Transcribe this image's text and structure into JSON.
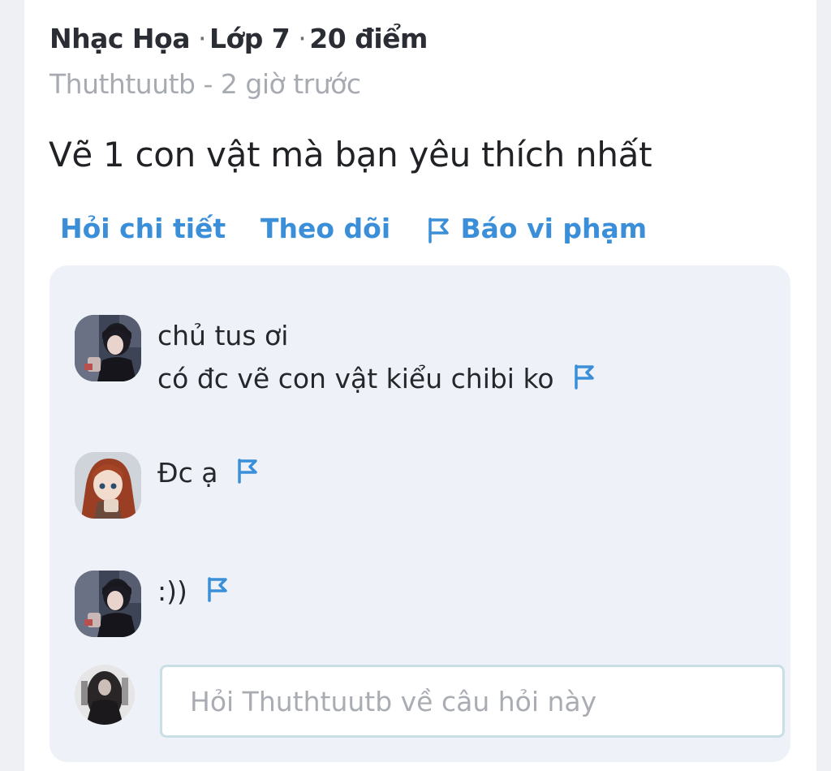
{
  "question": {
    "subject": "Nhạc Họa",
    "grade": "Lớp 7",
    "points": "20 điểm",
    "author": "Thuthtuutb",
    "meta_separator": "-",
    "time": "2 giờ trước",
    "text": "Vẽ 1 con vật mà bạn yêu thích nhất"
  },
  "actions": {
    "ask_detail": "Hỏi chi tiết",
    "follow": "Theo dõi",
    "report": "Báo vi phạm",
    "report_icon": "flag-icon"
  },
  "comments": [
    {
      "lines": [
        "chủ tus ơi",
        "có đc vẽ con vật kiểu chibi ko"
      ],
      "avatar": "user-avatar-dark-hair"
    },
    {
      "lines": [
        "Đc ạ"
      ],
      "avatar": "user-avatar-red-hair"
    },
    {
      "lines": [
        ":))"
      ],
      "avatar": "user-avatar-dark-hair"
    }
  ],
  "reply": {
    "placeholder": "Hỏi Thuthtuutb về câu hỏi này",
    "avatar": "current-user-avatar"
  },
  "colors": {
    "accent": "#3a8fd8",
    "comment_bg": "#eef2f8",
    "muted_text": "#a7abb1"
  }
}
